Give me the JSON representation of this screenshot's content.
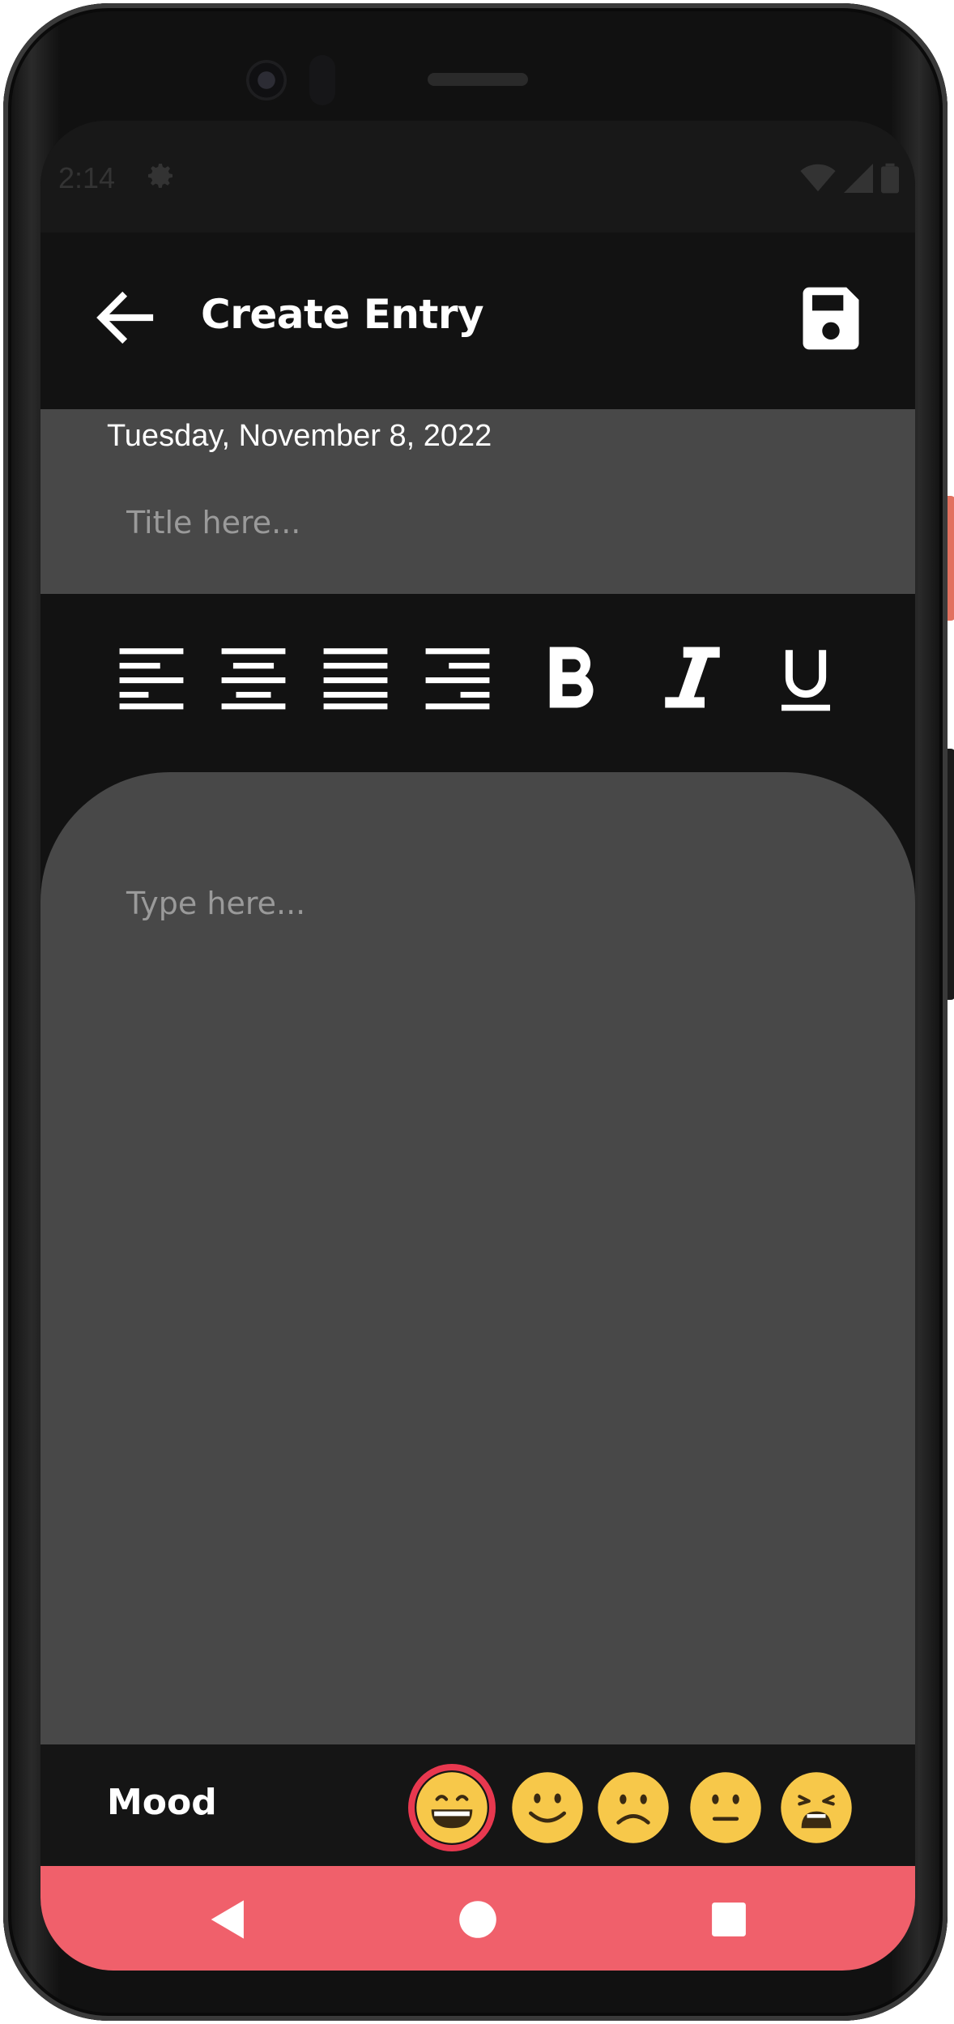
{
  "status_bar": {
    "time": "2:14",
    "icons": [
      "settings-icon",
      "wifi-icon",
      "signal-icon",
      "battery-icon"
    ]
  },
  "topbar": {
    "title": "Create Entry",
    "back_icon": "arrow-left-icon",
    "save_icon": "floppy-disk-icon"
  },
  "entry": {
    "date": "Tuesday, November 8, 2022",
    "title_placeholder": "Title here...",
    "body_placeholder": "Type here..."
  },
  "format_toolbar": {
    "buttons": [
      "align-left-icon",
      "align-center-icon",
      "align-justify-icon",
      "align-right-icon",
      "bold-icon",
      "italic-icon",
      "underline-icon"
    ]
  },
  "mood": {
    "label": "Mood",
    "options": [
      "grinning",
      "smiling",
      "frowning",
      "neutral",
      "weary"
    ],
    "selected": "grinning",
    "selected_ring_color": "#e8384f"
  },
  "colors": {
    "background": "#121212",
    "panel": "#484848",
    "nav_accent": "#f0606b"
  },
  "nav": {
    "buttons": [
      "back-triangle-icon",
      "home-circle-icon",
      "recents-square-icon"
    ]
  }
}
